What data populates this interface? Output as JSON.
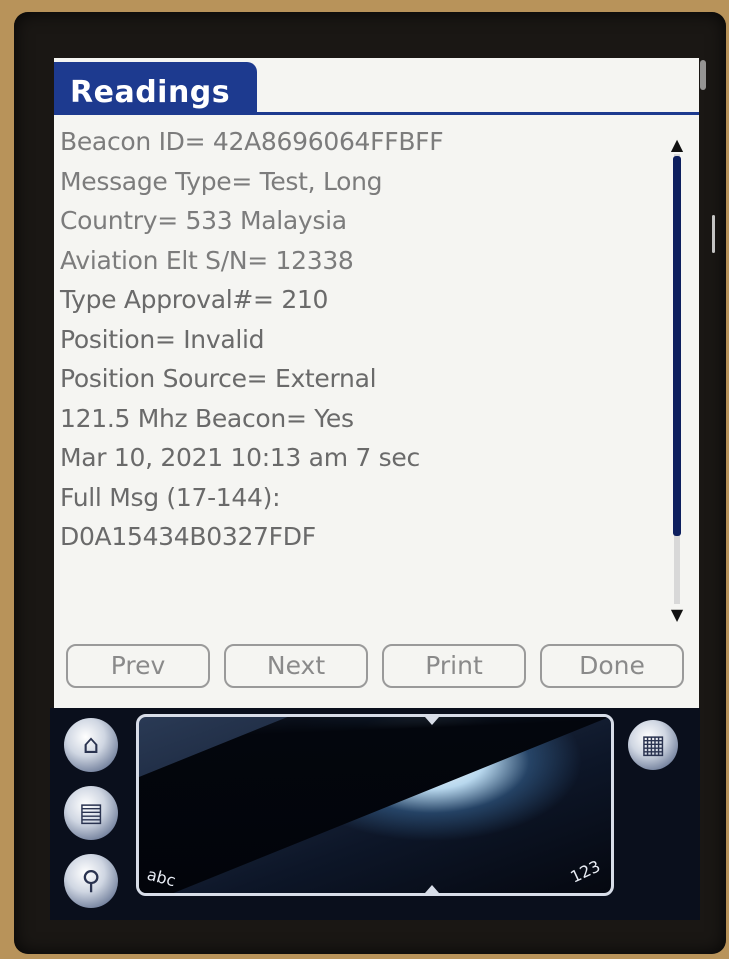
{
  "window": {
    "title": "Readings"
  },
  "readings": {
    "lines": [
      "Beacon ID= 42A8696064FFBFF",
      "Message Type= Test, Long",
      "Country= 533 Malaysia",
      "Aviation Elt S/N= 12338",
      "Type Approval#= 210",
      "Position= Invalid",
      "Position Source= External",
      "121.5 Mhz Beacon= Yes",
      "Mar 10, 2021 10:13 am 7 sec",
      "Full Msg (17-144):",
      "D0A15434B0327FDF"
    ]
  },
  "buttons": {
    "prev": "Prev",
    "next": "Next",
    "print": "Print",
    "done": "Done"
  },
  "graffiti": {
    "left_label": "abc",
    "right_label": "123"
  },
  "icons": {
    "home": "home-icon",
    "menu": "menu-icon",
    "find": "find-icon",
    "calc": "calculator-icon",
    "scroll_up": "arrow-up-icon",
    "scroll_down": "arrow-down-icon"
  },
  "colors": {
    "title_bar": "#1d3a8f",
    "text": "#7c7c7c",
    "scroll_thumb": "#0d1f5e"
  }
}
